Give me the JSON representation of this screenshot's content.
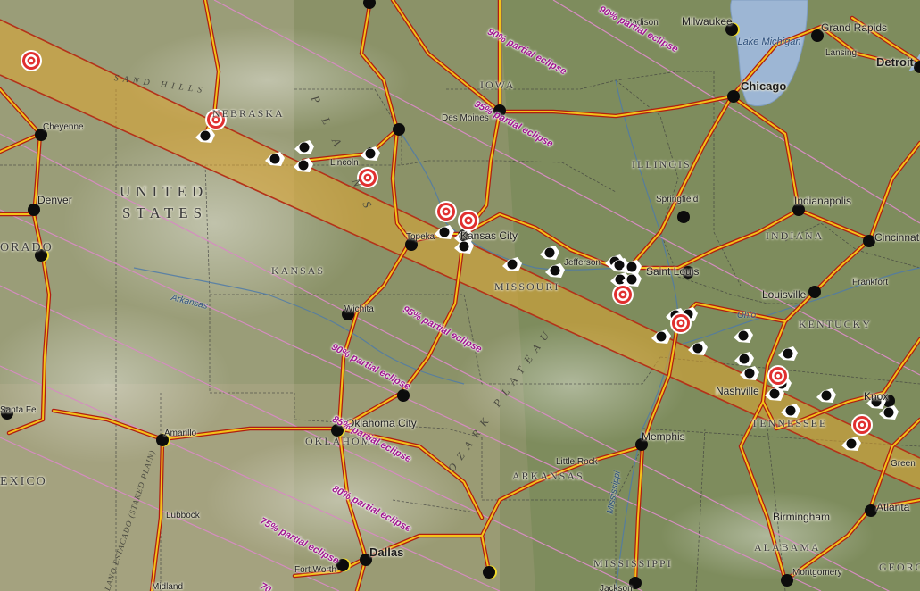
{
  "map": {
    "country_label": [
      "UNITED",
      "STATES"
    ],
    "regions": [
      {
        "id": "sand-hills",
        "label": "SAND HILLS"
      },
      {
        "id": "plains",
        "label": "P L A I N S"
      },
      {
        "id": "ozark-plateau",
        "label": "OZARK PLATEAU"
      },
      {
        "id": "staked-plain",
        "label": "LLANO ESTACADO (STAKED PLAIN)"
      }
    ],
    "states": [
      {
        "id": "nebraska",
        "label": "NEBRASKA"
      },
      {
        "id": "iowa",
        "label": "IOWA"
      },
      {
        "id": "illinois",
        "label": "ILLINOIS"
      },
      {
        "id": "indiana",
        "label": "INDIANA"
      },
      {
        "id": "kansas",
        "label": "KANSAS"
      },
      {
        "id": "missouri",
        "label": "MISSOURI"
      },
      {
        "id": "kentucky",
        "label": "KENTUCKY"
      },
      {
        "id": "tennessee",
        "label": "TENNESSEE"
      },
      {
        "id": "oklahoma",
        "label": "OKLAHOMA"
      },
      {
        "id": "arkansas",
        "label": "ARKANSAS"
      },
      {
        "id": "mississippi",
        "label": "MISSISSIPPI"
      },
      {
        "id": "alabama",
        "label": "ALABAMA"
      },
      {
        "id": "colorado",
        "label": "ORADO"
      },
      {
        "id": "new-mexico",
        "label": "EXICO"
      },
      {
        "id": "georgia",
        "label": "GEORG"
      }
    ],
    "cities": [
      {
        "id": "madison",
        "label": "Madison"
      },
      {
        "id": "milwaukee",
        "label": "Milwaukee"
      },
      {
        "id": "grand-rapids",
        "label": "Grand Rapids"
      },
      {
        "id": "lansing",
        "label": "Lansing"
      },
      {
        "id": "detroit",
        "label": "Detroit"
      },
      {
        "id": "chicago",
        "label": "Chicago"
      },
      {
        "id": "cheyenne",
        "label": "Cheyenne"
      },
      {
        "id": "des-moines",
        "label": "Des Moines"
      },
      {
        "id": "lincoln",
        "label": "Lincoln"
      },
      {
        "id": "denver",
        "label": "Denver"
      },
      {
        "id": "topeka",
        "label": "Topeka"
      },
      {
        "id": "kansas-city",
        "label": "Kansas City"
      },
      {
        "id": "springfield",
        "label": "Springfield"
      },
      {
        "id": "indianapolis",
        "label": "Indianapolis"
      },
      {
        "id": "cincinnati",
        "label": "Cincinnati"
      },
      {
        "id": "jefferson-city",
        "label": "Jefferson"
      },
      {
        "id": "saint-louis",
        "label": "Saint Louis"
      },
      {
        "id": "frankfort",
        "label": "Frankfort"
      },
      {
        "id": "louisville",
        "label": "Louisville"
      },
      {
        "id": "wichita",
        "label": "Wichita"
      },
      {
        "id": "nashville",
        "label": "Nashville"
      },
      {
        "id": "knoxville",
        "label": "Knox"
      },
      {
        "id": "santa-fe",
        "label": "Santa Fe"
      },
      {
        "id": "amarillo",
        "label": "Amarillo"
      },
      {
        "id": "oklahoma-city",
        "label": "Oklahoma City"
      },
      {
        "id": "memphis",
        "label": "Memphis"
      },
      {
        "id": "little-rock",
        "label": "Little Rock"
      },
      {
        "id": "lubbock",
        "label": "Lubbock"
      },
      {
        "id": "birmingham",
        "label": "Birmingham"
      },
      {
        "id": "atlanta",
        "label": "Atlanta"
      },
      {
        "id": "greenville",
        "label": "Green"
      },
      {
        "id": "dallas",
        "label": "Dallas"
      },
      {
        "id": "fort-worth",
        "label": "Fort Worth"
      },
      {
        "id": "midland",
        "label": "Midland"
      },
      {
        "id": "montgomery",
        "label": "Montgomery"
      },
      {
        "id": "jackson",
        "label": "Jackson"
      }
    ],
    "waters": [
      {
        "id": "lake-michigan",
        "label": "Lake Michigan"
      },
      {
        "id": "arkansas-river",
        "label": "Arkansas"
      },
      {
        "id": "ohio-river",
        "label": "Ohio"
      },
      {
        "id": "mississippi-river",
        "label": "Mississippi"
      }
    ],
    "eclipse_labels": [
      {
        "id": "e-90-north-1",
        "label": "90% partial eclipse",
        "percent": 90
      },
      {
        "id": "e-90-north-2",
        "label": "90% partial eclipse",
        "percent": 90
      },
      {
        "id": "e-95-north",
        "label": "95% partial eclipse",
        "percent": 95
      },
      {
        "id": "e-95-south",
        "label": "95% partial eclipse",
        "percent": 95
      },
      {
        "id": "e-90-south",
        "label": "90% partial eclipse",
        "percent": 90
      },
      {
        "id": "e-85-south",
        "label": "85% partial eclipse",
        "percent": 85
      },
      {
        "id": "e-80-south",
        "label": "80% partial eclipse",
        "percent": 80
      },
      {
        "id": "e-75-south",
        "label": "75% partial eclipse",
        "percent": 75
      },
      {
        "id": "e-70-south",
        "label": "70",
        "percent": 70
      }
    ],
    "legend_colors": {
      "totality_band": "#e0a530",
      "totality_edge": "#b43219",
      "partial_lines": "#d58cc0",
      "highway": "#f3c21a",
      "highway_casing": "#b01e10",
      "target_marker": "#e03030",
      "eclipse_label": "#a01590"
    },
    "marker_icons": {
      "target": "target-icon",
      "event": "event-icon",
      "city_dot": "city-dot-icon",
      "eclipse_dot": "eclipse-dot-icon"
    }
  }
}
